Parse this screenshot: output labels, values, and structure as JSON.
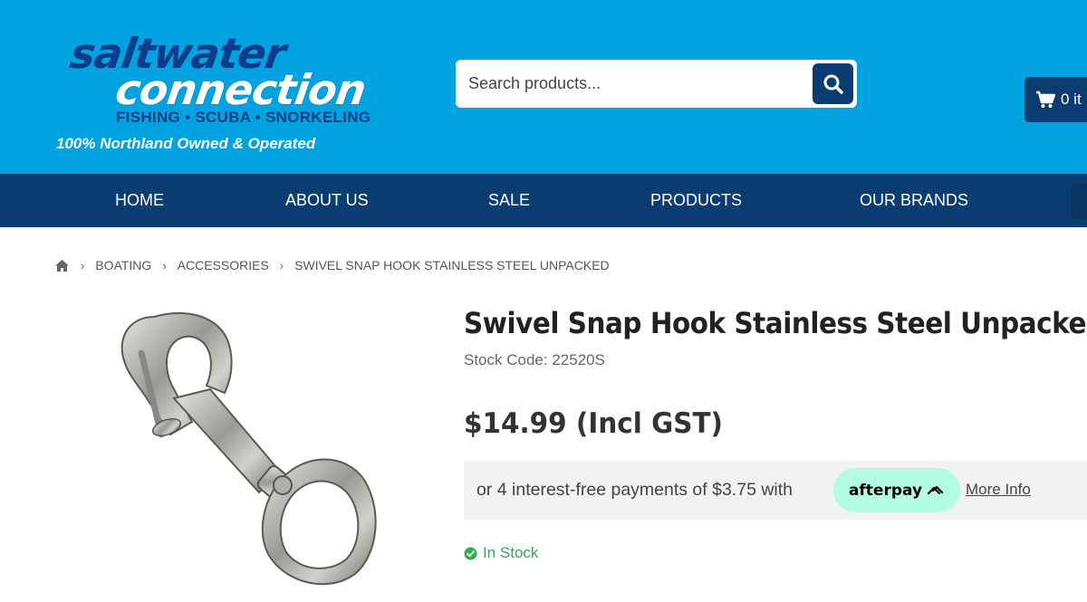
{
  "header": {
    "logo": {
      "line1": "saltwater",
      "line2": "connection",
      "tagline": "FISHING • SCUBA • SNORKELING",
      "owned": "100% Northland Owned & Operated"
    },
    "search": {
      "placeholder": "Search products..."
    },
    "cart": {
      "label": "0 it"
    }
  },
  "nav": {
    "items": [
      {
        "label": "HOME"
      },
      {
        "label": "ABOUT US"
      },
      {
        "label": "SALE"
      },
      {
        "label": "PRODUCTS"
      },
      {
        "label": "OUR BRANDS"
      }
    ]
  },
  "breadcrumb": {
    "items": [
      {
        "label": "BOATING"
      },
      {
        "label": "ACCESSORIES"
      },
      {
        "label": "SWIVEL SNAP HOOK STAINLESS STEEL UNPACKED"
      }
    ]
  },
  "product": {
    "title": "Swivel Snap Hook Stainless Steel Unpacked",
    "stock_code": "Stock Code: 22520S",
    "price": "$14.99 (Incl GST)",
    "afterpay": {
      "text": "or 4 interest-free payments of $3.75 with",
      "badge": "afterpay",
      "more_info": "More Info"
    },
    "availability": "In Stock"
  },
  "colors": {
    "header_bg": "#00a3e0",
    "nav_bg": "#0b3d72",
    "afterpay_badge": "#b2fce4",
    "in_stock": "#2eae4d"
  }
}
